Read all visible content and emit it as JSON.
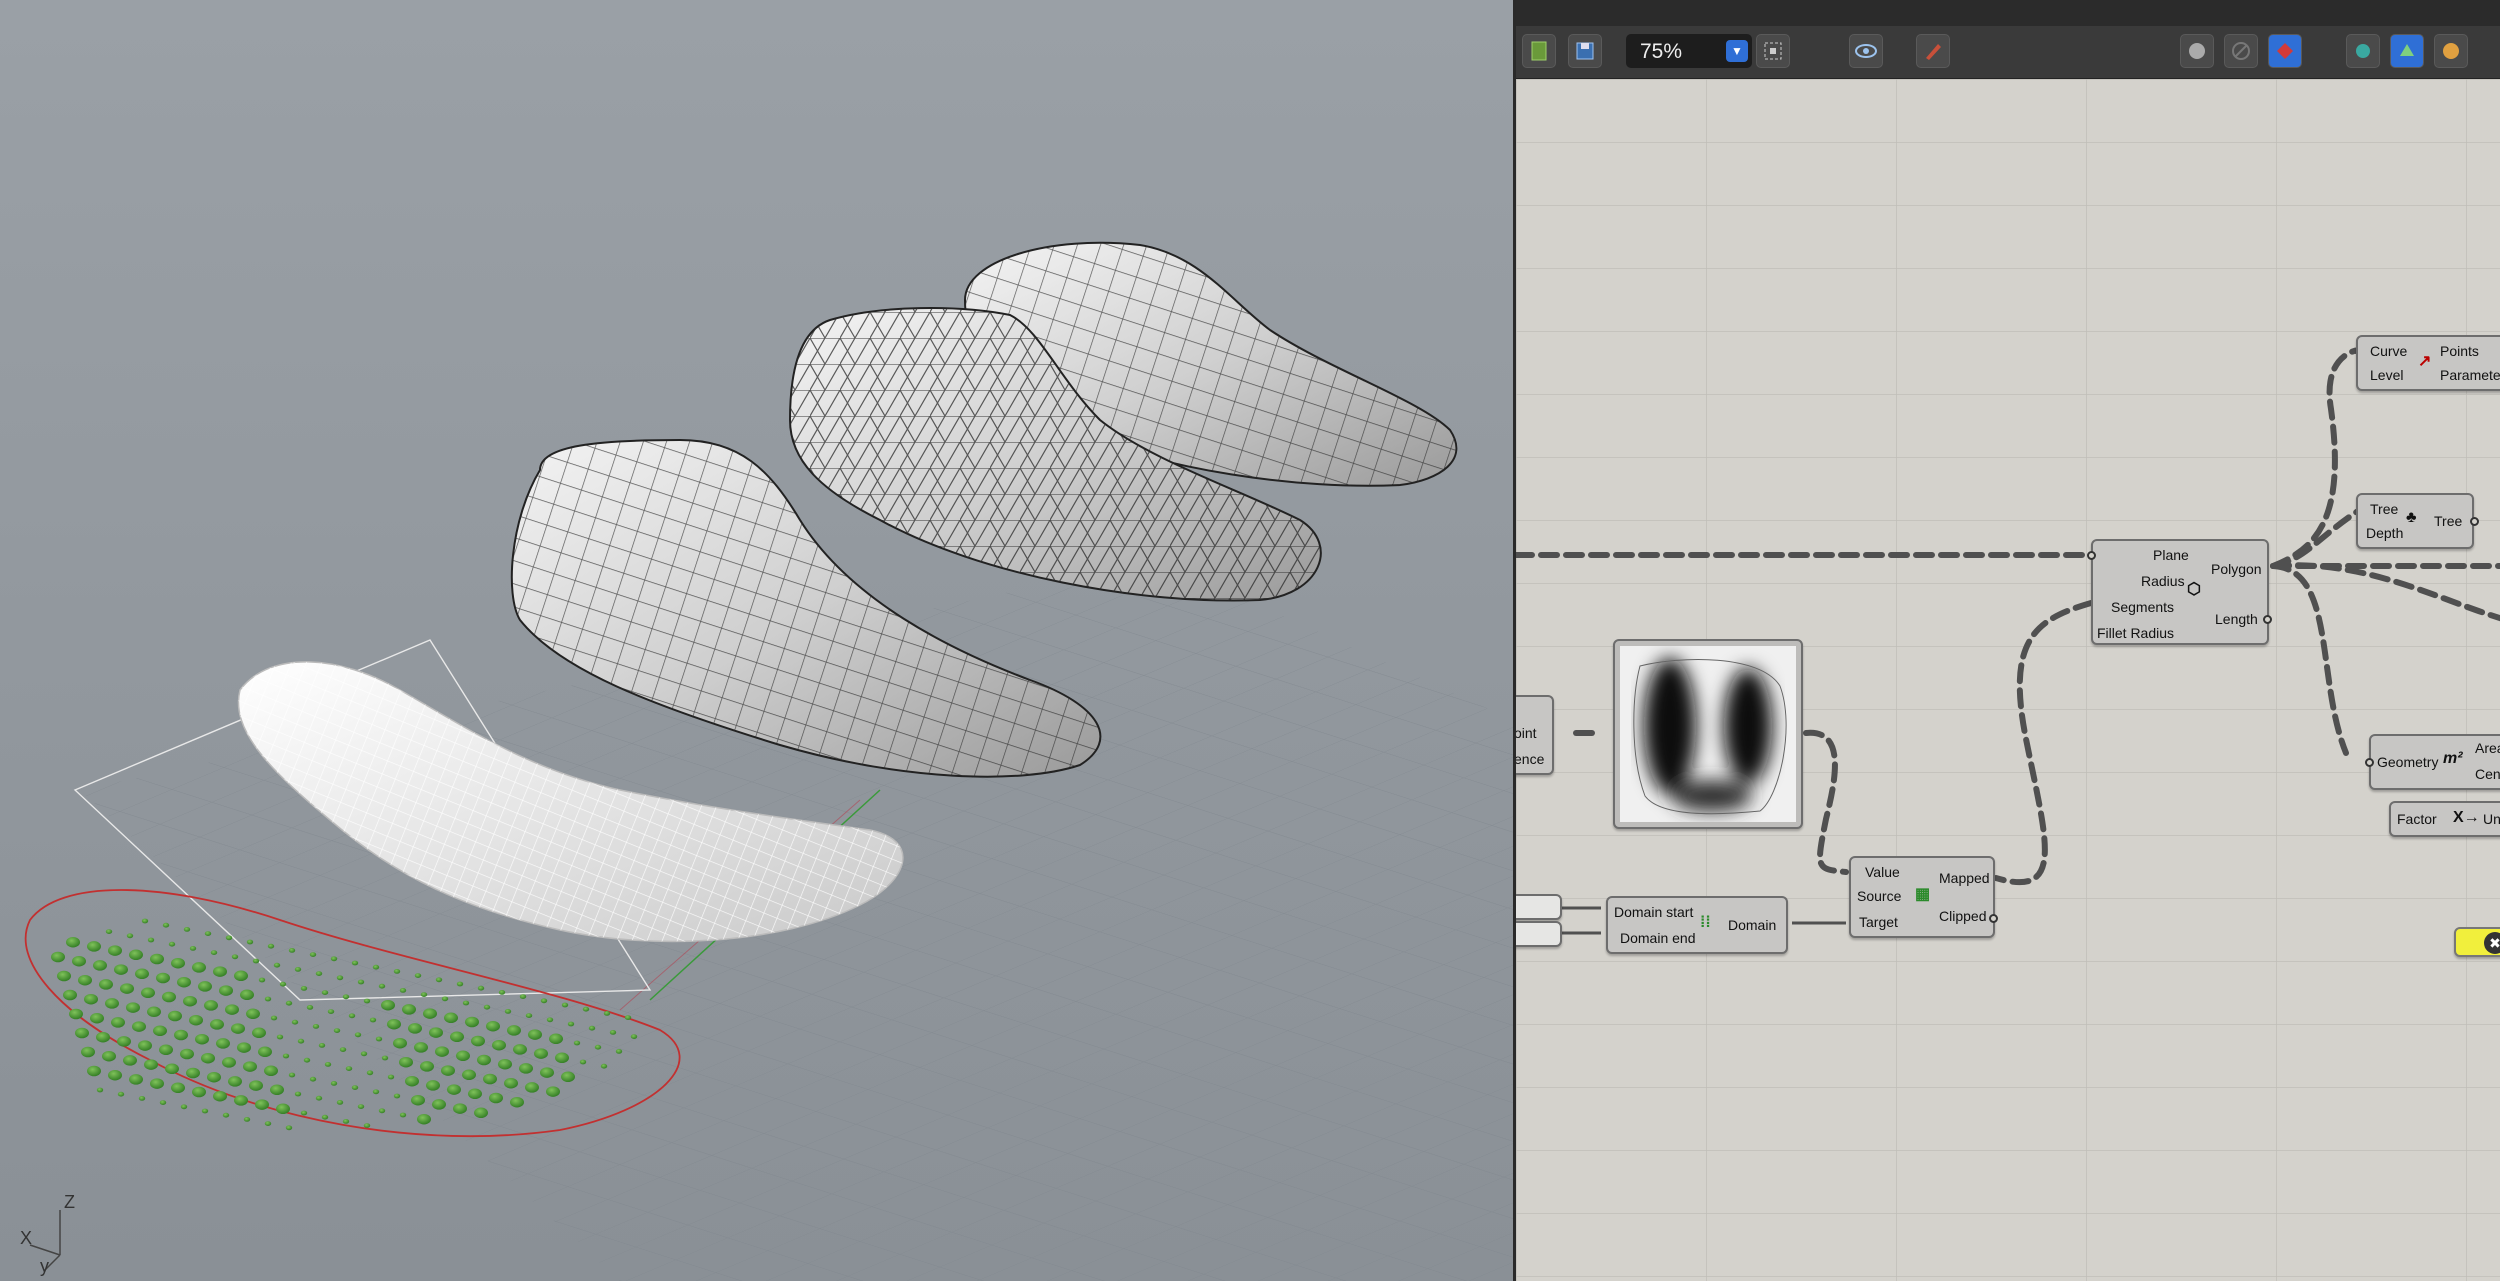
{
  "toolbar": {
    "zoom_value": "75%",
    "buttons": [
      "new-file-icon",
      "save-icon",
      "zoom-extents-icon",
      "preview-eye-icon",
      "sketch-pen-icon",
      "shaded-sphere-icon",
      "wireframe-disable-icon",
      "red-gem-icon",
      "teal-shape-icon",
      "blue-shape-icon",
      "orange-sphere-icon"
    ]
  },
  "viewport": {
    "axis_z": "Z",
    "axis_x": "X",
    "axis_y": "y"
  },
  "nodes": {
    "divide_curve": {
      "in1": "Curve",
      "in2": "Level",
      "out1": "Points",
      "out2": "Parameters"
    },
    "tree_stat": {
      "in1": "Tree",
      "in2": "Depth",
      "out1": "Tree"
    },
    "polygon": {
      "in1": "Plane",
      "in2": "Radius",
      "in3": "Segments",
      "in4": "Fillet Radius",
      "out1": "Polygon",
      "out2": "Length"
    },
    "partial_left": {
      "l1": "oint",
      "l2": "ence"
    },
    "area": {
      "in1": "Geometry",
      "out1": "Area",
      "out2": "Cent"
    },
    "unit_x": {
      "in1": "Factor",
      "out1": "Unit"
    },
    "remap": {
      "in1": "Value",
      "in2": "Source",
      "in3": "Target",
      "out1": "Mapped",
      "out2": "Clipped"
    },
    "construct_domain": {
      "in1": "Domain start",
      "in2": "Domain end",
      "out1": "Domain"
    },
    "slider_a": "",
    "slider_b": ""
  }
}
